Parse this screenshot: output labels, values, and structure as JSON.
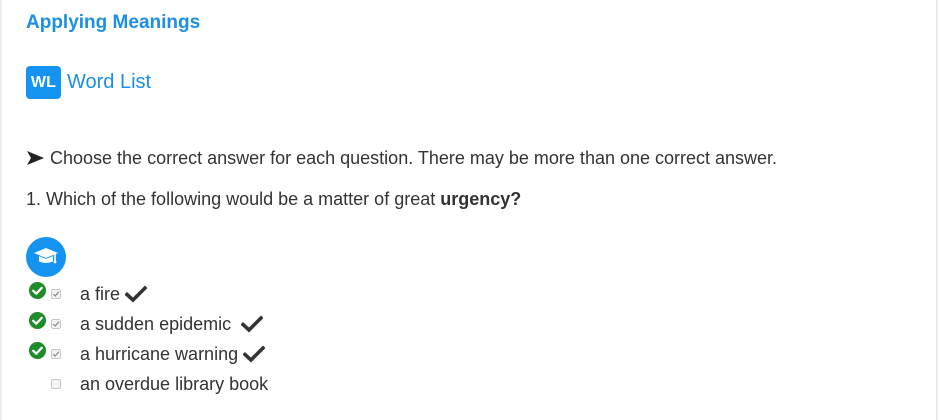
{
  "section": {
    "title": "Applying Meanings"
  },
  "word_list": {
    "badge": "WL",
    "label": "Word List"
  },
  "instruction": "Choose the correct answer for each question. There may be more than one correct answer.",
  "question": {
    "prefix": "1. Which of the following would be a matter of great ",
    "keyword": "urgency?"
  },
  "choices": [
    {
      "label": "a fire",
      "checked": true,
      "correct": true
    },
    {
      "label": "a sudden epidemic",
      "checked": true,
      "correct": true
    },
    {
      "label": "a hurricane warning",
      "checked": true,
      "correct": true
    },
    {
      "label": "an overdue library book",
      "checked": false,
      "correct": false
    }
  ],
  "icons": {
    "instruction_arrow": "arrowhead-icon",
    "learn": "graduation-cap-icon",
    "correct_status": "green-check-circle-icon",
    "correct_mark": "checkmark-icon"
  },
  "colors": {
    "accent": "#1b8fe3",
    "badge": "#1593f0",
    "correct": "#1e8c2a",
    "text": "#333333"
  }
}
